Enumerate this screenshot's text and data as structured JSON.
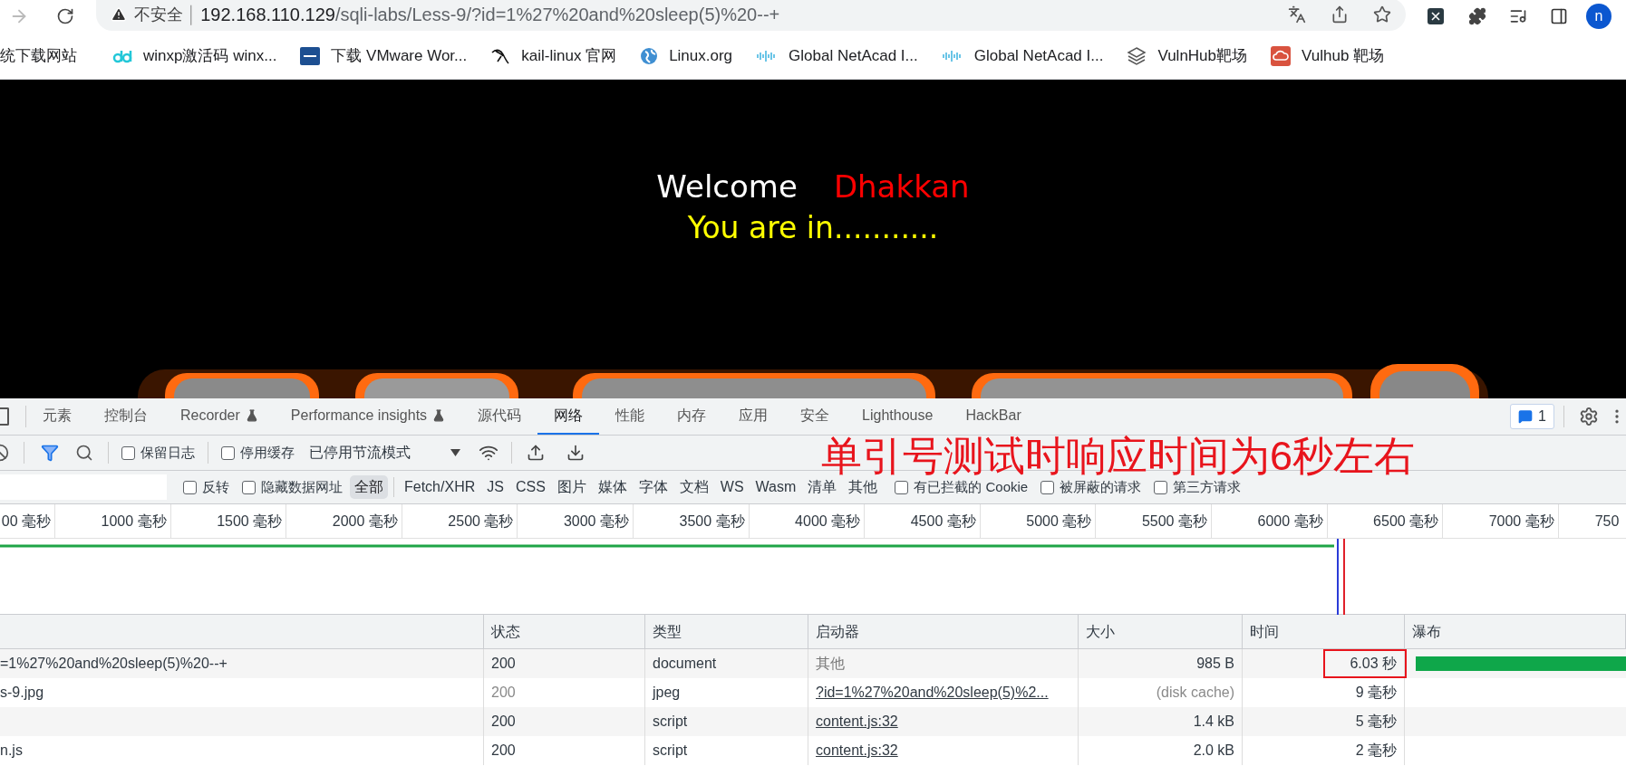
{
  "browser": {
    "insecure_label": "不安全",
    "separator": "│",
    "url": {
      "host": "192.168.110.129",
      "path": "/sqli-labs/Less-9/?id=1%27%20and%20sleep(5)%20--+"
    },
    "avatar": "n",
    "back_disabled": true
  },
  "bookmarks": [
    {
      "label": "统下载网站",
      "kind": "none"
    },
    {
      "label": "winxp激活码 winx...",
      "kind": "dd"
    },
    {
      "label": "下载 VMware Wor...",
      "kind": "vmw"
    },
    {
      "label": "kail-linux 官网",
      "kind": "dragon"
    },
    {
      "label": "Linux.org",
      "kind": "globe"
    },
    {
      "label": "Global NetAcad I...",
      "kind": "cisco"
    },
    {
      "label": "Global NetAcad I...",
      "kind": "cisco"
    },
    {
      "label": "VulnHub靶场",
      "kind": "cube"
    },
    {
      "label": "Vulhub 靶场",
      "kind": "cloud"
    }
  ],
  "page": {
    "welcome": "Welcome",
    "name": "Dhakkan",
    "message": "You are in..........."
  },
  "devtools": {
    "tabs": [
      {
        "label": "元素",
        "selected": false,
        "experimental": false
      },
      {
        "label": "控制台",
        "selected": false,
        "experimental": false
      },
      {
        "label": "Recorder",
        "selected": false,
        "experimental": true
      },
      {
        "label": "Performance insights",
        "selected": false,
        "experimental": true
      },
      {
        "label": "源代码",
        "selected": false,
        "experimental": false
      },
      {
        "label": "网络",
        "selected": true,
        "experimental": false
      },
      {
        "label": "性能",
        "selected": false,
        "experimental": false
      },
      {
        "label": "内存",
        "selected": false,
        "experimental": false
      },
      {
        "label": "应用",
        "selected": false,
        "experimental": false
      },
      {
        "label": "安全",
        "selected": false,
        "experimental": false
      },
      {
        "label": "Lighthouse",
        "selected": false,
        "experimental": false
      },
      {
        "label": "HackBar",
        "selected": false,
        "experimental": false
      }
    ],
    "issues_count": "1",
    "toolbar": {
      "filter_on": true,
      "preserve_log": {
        "label": "保留日志",
        "checked": false
      },
      "disable_cache": {
        "label": "停用缓存",
        "checked": false
      },
      "throttling": "已停用节流模式"
    },
    "filters": {
      "invert": {
        "label": "反转",
        "checked": false
      },
      "hide_data_urls": {
        "label": "隐藏数据网址",
        "checked": false
      },
      "types": [
        {
          "label": "全部",
          "selected": true
        },
        {
          "label": "Fetch/XHR",
          "selected": false
        },
        {
          "label": "JS",
          "selected": false
        },
        {
          "label": "CSS",
          "selected": false
        },
        {
          "label": "图片",
          "selected": false
        },
        {
          "label": "媒体",
          "selected": false
        },
        {
          "label": "字体",
          "selected": false
        },
        {
          "label": "文档",
          "selected": false
        },
        {
          "label": "WS",
          "selected": false
        },
        {
          "label": "Wasm",
          "selected": false
        },
        {
          "label": "清单",
          "selected": false
        },
        {
          "label": "其他",
          "selected": false
        }
      ],
      "extra": [
        {
          "label": "有已拦截的 Cookie",
          "checked": false
        },
        {
          "label": "被屏蔽的请求",
          "checked": false
        },
        {
          "label": "第三方请求",
          "checked": false
        }
      ]
    },
    "timeline_ticks": [
      "00 毫秒",
      "1000 毫秒",
      "1500 毫秒",
      "2000 毫秒",
      "2500 毫秒",
      "3000 毫秒",
      "3500 毫秒",
      "4000 毫秒",
      "4500 毫秒",
      "5000 毫秒",
      "5500 毫秒",
      "6000 毫秒",
      "6500 毫秒",
      "7000 毫秒",
      "750"
    ],
    "annotation": "单引号测试时响应时间为6秒左右",
    "table": {
      "columns": [
        "状态",
        "类型",
        "启动器",
        "大小",
        "时间",
        "瀑布"
      ],
      "rows": [
        {
          "name": "=1%27%20and%20sleep(5)%20--+",
          "status": "200",
          "type": "document",
          "initiator": "其他",
          "initiator_link": false,
          "size": "985 B",
          "time": "6.03 秒",
          "cached": false,
          "highlighted": true,
          "waterfall": true
        },
        {
          "name": "s-9.jpg",
          "status": "200",
          "type": "jpeg",
          "initiator": "?id=1%27%20and%20sleep(5)%2...",
          "initiator_link": true,
          "size": "(disk cache)",
          "time": "9 毫秒",
          "cached": true,
          "highlighted": false,
          "waterfall": false
        },
        {
          "status": "200",
          "type": "script",
          "initiator": "content.js:32",
          "initiator_link": true,
          "size": "1.4 kB",
          "time": "5 毫秒",
          "cached": false,
          "highlighted": false,
          "waterfall": false
        },
        {
          "name": "n.js",
          "status": "200",
          "type": "script",
          "initiator": "content.js:32",
          "initiator_link": true,
          "size": "2.0 kB",
          "time": "2 毫秒",
          "cached": false,
          "highlighted": false,
          "waterfall": false
        }
      ]
    }
  }
}
